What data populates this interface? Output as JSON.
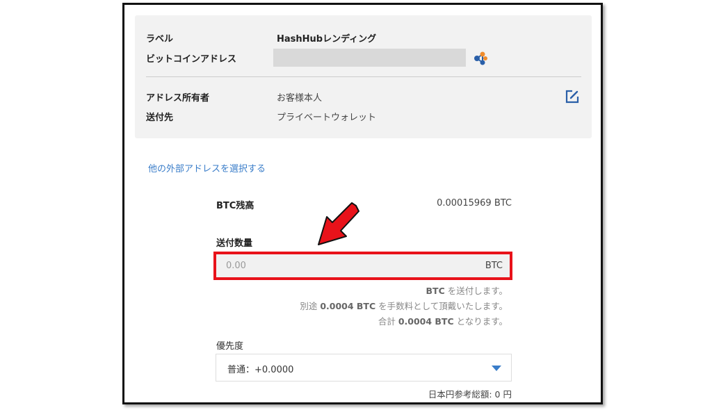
{
  "info": {
    "label_key": "ラベル",
    "label_value": "HashHubレンディング",
    "address_key": "ビットコインアドレス",
    "owner_key": "アドレス所有者",
    "owner_value": "お客様本人",
    "dest_key": "送付先",
    "dest_value": "プライベートウォレット"
  },
  "select_other_link": "他の外部アドレスを選択する",
  "balance": {
    "label": "BTC残高",
    "value": "0.00015969 BTC"
  },
  "quantity": {
    "label": "送付数量",
    "placeholder": "0.00",
    "unit": "BTC"
  },
  "notes": {
    "line1_bold": "BTC",
    "line1_text": " を送付します。",
    "line2_pre": "別途 ",
    "line2_bold": "0.0004 BTC",
    "line2_post": " を手数料として頂戴いたします。",
    "line3_pre": "合計 ",
    "line3_bold": "0.0004 BTC",
    "line3_post": " となります。"
  },
  "priority": {
    "label": "優先度",
    "selected": "普通：+0.0000"
  },
  "jpy_reference": "日本円参考総額: 0 円",
  "colors": {
    "link": "#3a7dc9",
    "highlight": "#e8121a",
    "arrow": "#e8121a"
  },
  "icons": [
    "network-share-icon",
    "edit-icon",
    "dropdown-caret-icon",
    "red-arrow-annotation"
  ]
}
